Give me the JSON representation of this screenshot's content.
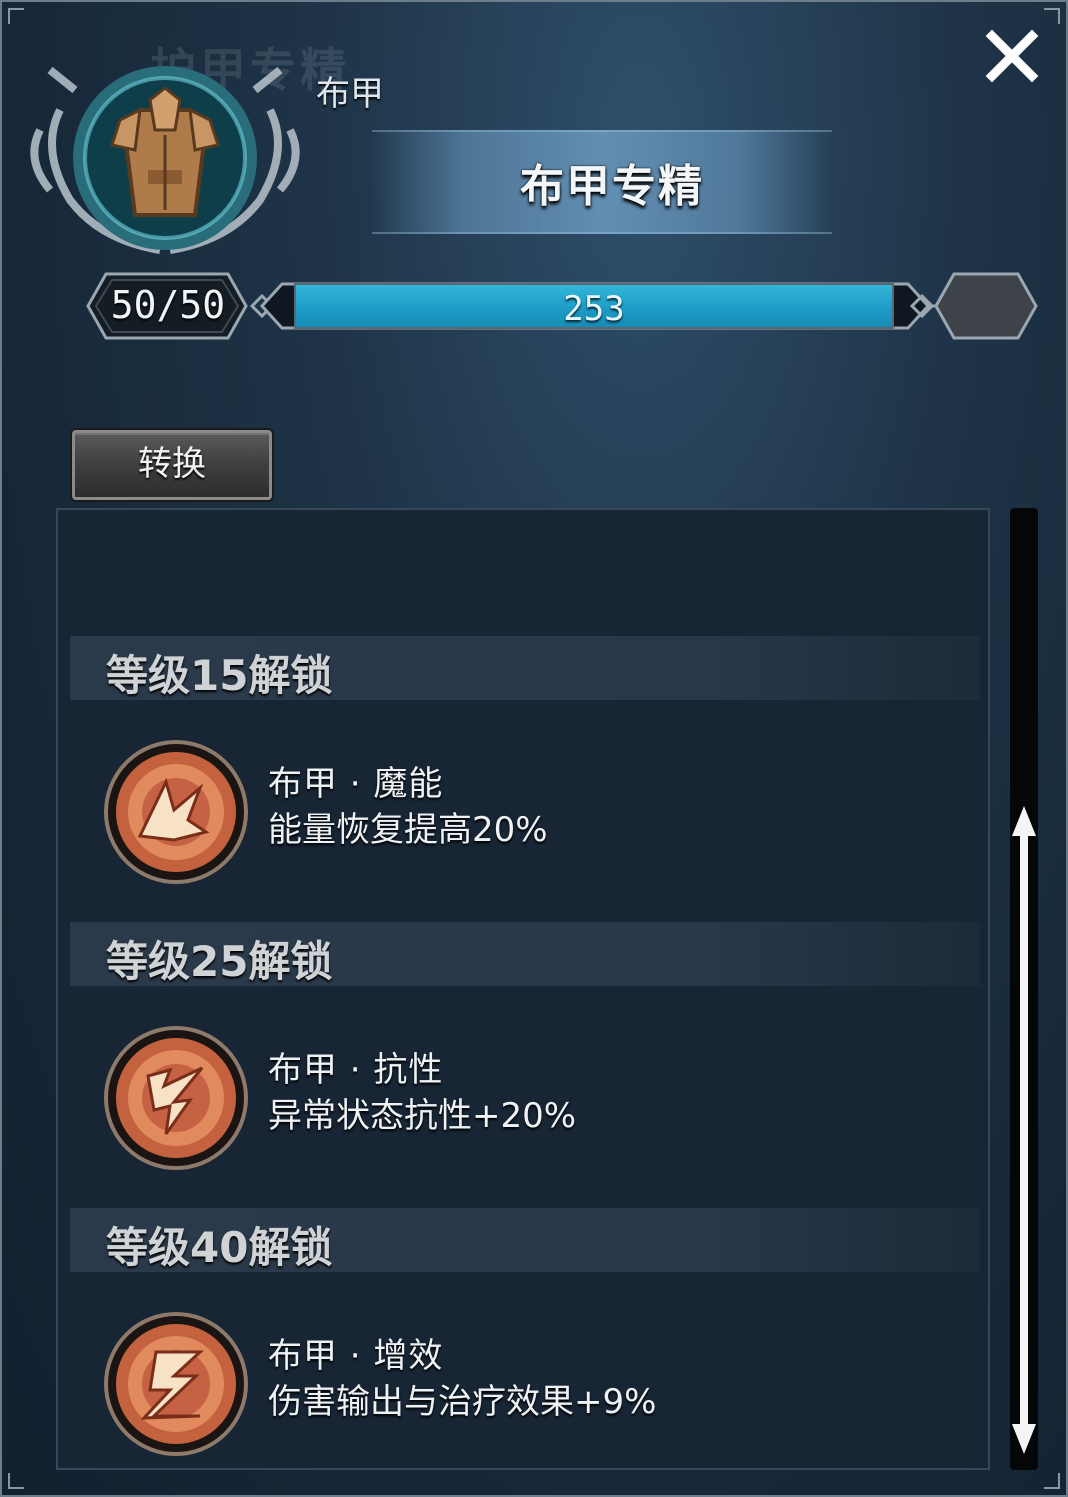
{
  "header": {
    "watermark": "护甲专精",
    "subtitle": "布甲",
    "title": "布甲专精"
  },
  "progress": {
    "level_text": "50/50",
    "xp_value": "253",
    "fill_fraction": 1.0
  },
  "actions": {
    "convert_label": "转换"
  },
  "unlocks": [
    {
      "header": "等级15解锁",
      "perk_name": "布甲 · 魔能",
      "perk_desc": "能量恢复提高20%",
      "icon": "magic-energy-rune-icon"
    },
    {
      "header": "等级25解锁",
      "perk_name": "布甲 · 抗性",
      "perk_desc": "异常状态抗性+20%",
      "icon": "resistance-rune-icon"
    },
    {
      "header": "等级40解锁",
      "perk_name": "布甲 · 增效",
      "perk_desc": "伤害输出与治疗效果+9%",
      "icon": "boost-rune-icon"
    }
  ],
  "icons": {
    "emblem": "cloth-armor-icon",
    "close": "close-icon",
    "scroll": "scroll-arrow-icon"
  },
  "colors": {
    "xp_fill": "#1e9cc6",
    "panel_bg": "#172534",
    "rune_orange": "#d9704a"
  }
}
